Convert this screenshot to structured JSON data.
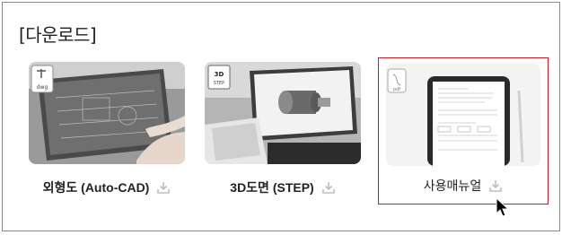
{
  "section": {
    "title": "[다운로드]"
  },
  "cards": [
    {
      "label": "외형도 (Auto-CAD)",
      "file_badge": "dwg",
      "icon": "download-icon"
    },
    {
      "label": "3D도면 (STEP)",
      "file_badge": "3D STEP",
      "icon": "download-icon"
    },
    {
      "label": "사용매뉴얼",
      "file_badge": "pdf",
      "icon": "download-icon"
    }
  ],
  "badges": {
    "step_top": "3D",
    "step_bottom": "STEP"
  },
  "colors": {
    "highlight_border": "#c0202a",
    "icon_gray": "#bdbdbd",
    "text": "#222222"
  }
}
